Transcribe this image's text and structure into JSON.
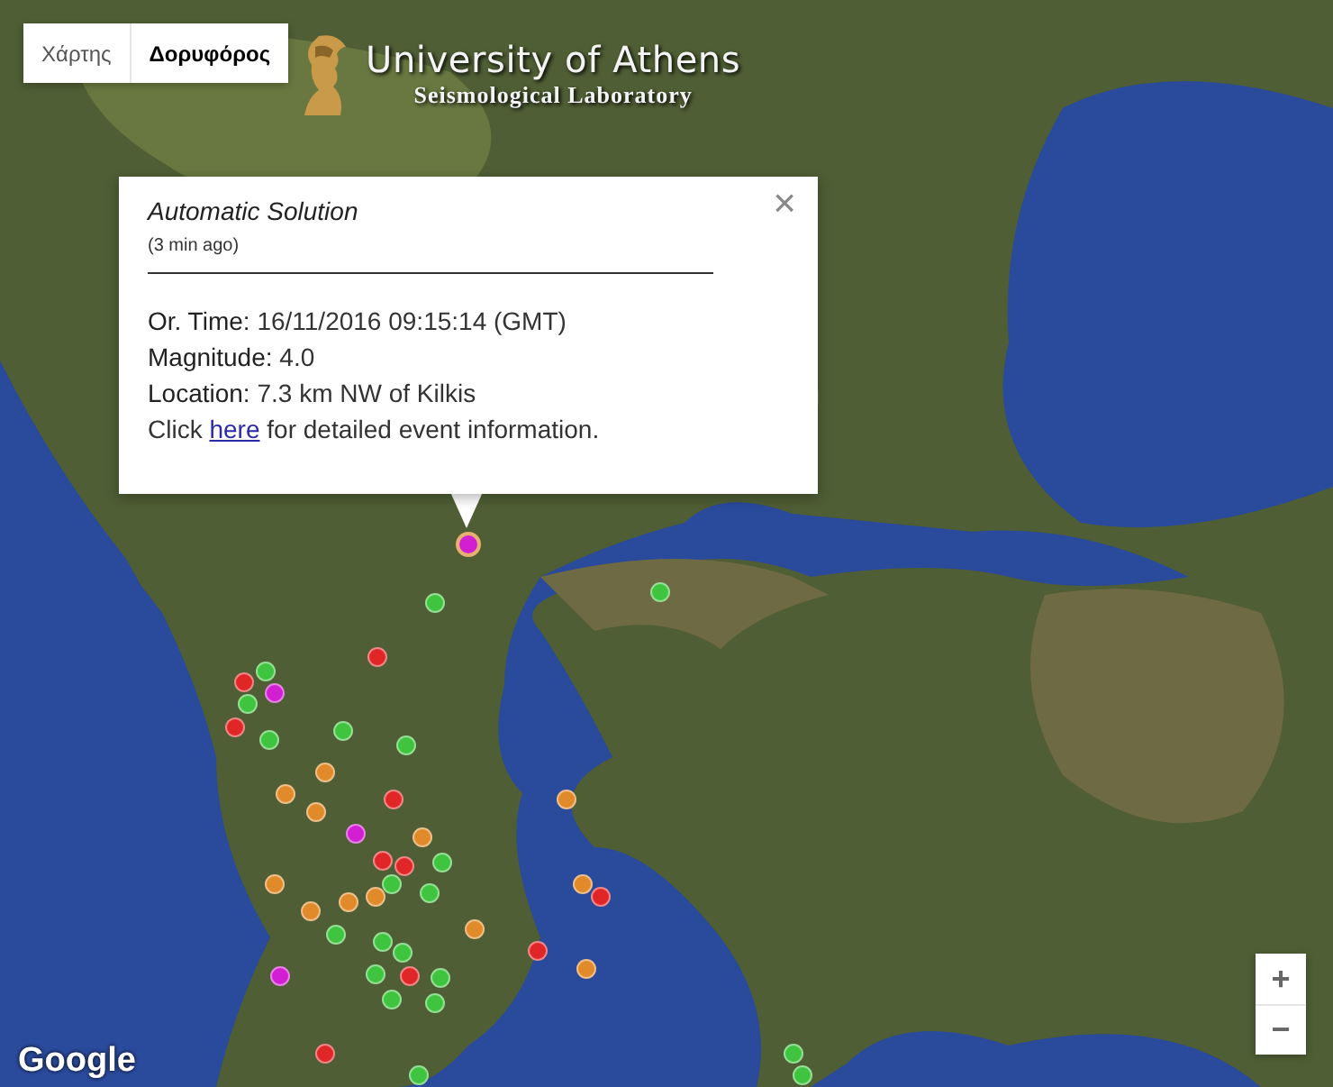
{
  "map_type_buttons": [
    {
      "label": "Χάρτης",
      "selected": false
    },
    {
      "label": "Δορυφόρος",
      "selected": true
    }
  ],
  "logo": {
    "title": "University of Athens",
    "subtitle": "Seismological Laboratory"
  },
  "popup": {
    "title": "Automatic Solution",
    "subtitle": "(3 min ago)",
    "close": "×",
    "lines": [
      {
        "label": "Or. Time:",
        "value": "16/11/2016 09:15:14 (GMT)"
      },
      {
        "label": "Magnitude:",
        "value": "4.0"
      },
      {
        "label": "Location:",
        "value": "7.3 km NW of Kilkis"
      }
    ],
    "link_line": {
      "before": "Click ",
      "link": "here",
      "after": " for detailed event information."
    }
  },
  "markers": [
    {
      "color": "#d21fd2",
      "selected": true
    },
    {
      "color": "#3fc43f",
      "selected": false
    },
    {
      "color": "#3fc43f",
      "selected": false
    },
    {
      "color": "#e02626",
      "selected": false
    },
    {
      "color": "#3fc43f",
      "selected": false
    },
    {
      "color": "#e02626",
      "selected": false
    },
    {
      "color": "#d21fd2",
      "selected": false
    },
    {
      "color": "#3fc43f",
      "selected": false
    },
    {
      "color": "#e02626",
      "selected": false
    },
    {
      "color": "#3fc43f",
      "selected": false
    },
    {
      "color": "#3fc43f",
      "selected": false
    },
    {
      "color": "#3fc43f",
      "selected": false
    },
    {
      "color": "#e08a2a",
      "selected": false
    },
    {
      "color": "#e08a2a",
      "selected": false
    },
    {
      "color": "#e02626",
      "selected": false
    },
    {
      "color": "#e08a2a",
      "selected": false
    },
    {
      "color": "#d21fd2",
      "selected": false
    },
    {
      "color": "#e08a2a",
      "selected": false
    },
    {
      "color": "#3fc43f",
      "selected": false
    },
    {
      "color": "#e02626",
      "selected": false
    },
    {
      "color": "#e02626",
      "selected": false
    },
    {
      "color": "#e08a2a",
      "selected": false
    },
    {
      "color": "#3fc43f",
      "selected": false
    },
    {
      "color": "#e08a2a",
      "selected": false
    },
    {
      "color": "#e02626",
      "selected": false
    },
    {
      "color": "#e08a2a",
      "selected": false
    },
    {
      "color": "#e08a2a",
      "selected": false
    },
    {
      "color": "#e08a2a",
      "selected": false
    },
    {
      "color": "#e08a2a",
      "selected": false
    },
    {
      "color": "#3fc43f",
      "selected": false
    },
    {
      "color": "#3fc43f",
      "selected": false
    },
    {
      "color": "#3fc43f",
      "selected": false
    },
    {
      "color": "#e08a2a",
      "selected": false
    },
    {
      "color": "#e02626",
      "selected": false
    },
    {
      "color": "#e08a2a",
      "selected": false
    },
    {
      "color": "#d21fd2",
      "selected": false
    },
    {
      "color": "#3fc43f",
      "selected": false
    },
    {
      "color": "#3fc43f",
      "selected": false
    },
    {
      "color": "#e02626",
      "selected": false
    },
    {
      "color": "#3fc43f",
      "selected": false
    },
    {
      "color": "#3fc43f",
      "selected": false
    },
    {
      "color": "#3fc43f",
      "selected": false
    },
    {
      "color": "#e02626",
      "selected": false
    },
    {
      "color": "#3fc43f",
      "selected": false
    },
    {
      "color": "#3fc43f",
      "selected": false
    },
    {
      "color": "#3fc43f",
      "selected": false
    }
  ],
  "zoom_controls": [
    "+",
    "−"
  ],
  "attribution": "Google"
}
